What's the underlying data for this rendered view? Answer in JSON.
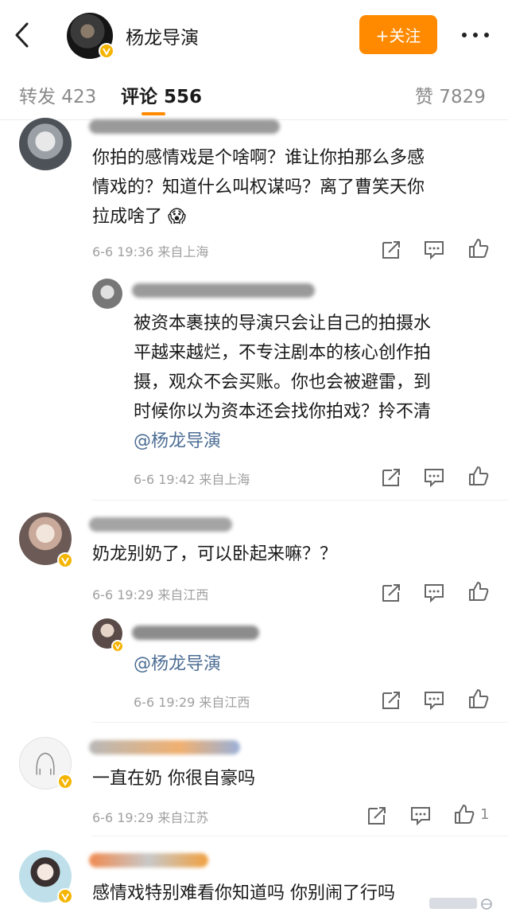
{
  "header": {
    "back_icon": "back-chevron-icon",
    "title": "杨龙导演",
    "follow_label": "+关注",
    "more_icon": "more-dots-icon",
    "accent": "#ff8a00",
    "verified_color": "#f5b400"
  },
  "tabs": [
    {
      "label": "转发 423",
      "active": false
    },
    {
      "label": "评论 556",
      "active": true
    },
    {
      "label": "赞 7829",
      "active": false
    }
  ],
  "comments": [
    {
      "lines": [
        "你拍的感情戏是个啥啊？谁让你拍那么多感",
        "情戏的？知道什么叫权谋吗？离了曹笑天你",
        "拉成啥了"
      ],
      "emoji": "😱",
      "meta": "6-6 19:36  来自上海"
    },
    {
      "lines": [
        "被资本裹挟的导演只会让自己的拍摄水",
        "平越来越烂，不专注剧本的核心创作拍",
        "摄，观众不会买账。你也会被避雷，到",
        "时候你以为资本还会找你拍戏？拎不清"
      ],
      "mention": "@杨龙导演",
      "meta": "6-6 19:42  来自上海"
    },
    {
      "lines": [
        "奶龙别奶了，可以卧起来嘛？？"
      ],
      "meta": "6-6 19:29  来自江西"
    },
    {
      "mention": "@杨龙导演",
      "meta": "6-6 19:29  来自江西"
    },
    {
      "lines": [
        "一直在奶 你很自豪吗"
      ],
      "meta": "6-6 19:29  来自江苏",
      "like_count": "1"
    },
    {
      "lines": [
        "感情戏特别难看你知道吗 你别闹了行吗"
      ]
    }
  ],
  "icons": {
    "share": "share-icon",
    "comment": "comment-icon",
    "like": "thumbs-up-icon"
  }
}
